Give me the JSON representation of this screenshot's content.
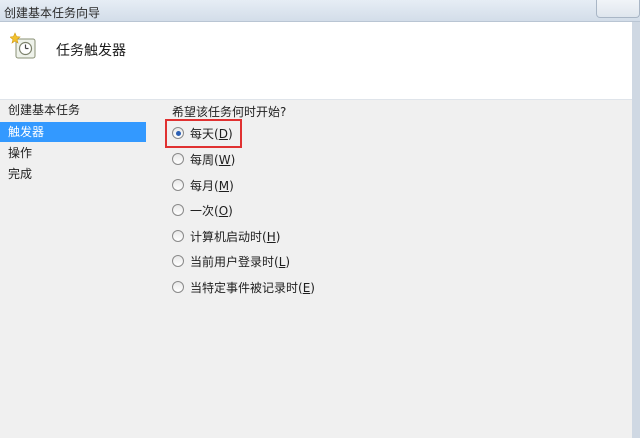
{
  "window": {
    "title": "创建基本任务向导"
  },
  "header": {
    "icon": "task-scheduler-wizard-icon",
    "heading": "任务触发器"
  },
  "sidebar": {
    "steps": [
      {
        "label": "创建基本任务"
      },
      {
        "label": "触发器"
      },
      {
        "label": "操作"
      },
      {
        "label": "完成"
      }
    ],
    "active_index": 1,
    "active_color": "#3399ff"
  },
  "main": {
    "question": "希望该任务何时开始?",
    "options": [
      {
        "label": "每天",
        "accel": "D",
        "checked": true
      },
      {
        "label": "每周",
        "accel": "W",
        "checked": false
      },
      {
        "label": "每月",
        "accel": "M",
        "checked": false
      },
      {
        "label": "一次",
        "accel": "O",
        "checked": false
      },
      {
        "label": "计算机启动时",
        "accel": "H",
        "checked": false
      },
      {
        "label": "当前用户登录时",
        "accel": "L",
        "checked": false
      },
      {
        "label": "当特定事件被记录时",
        "accel": "E",
        "checked": false
      }
    ],
    "highlight_color": "#e03131"
  }
}
